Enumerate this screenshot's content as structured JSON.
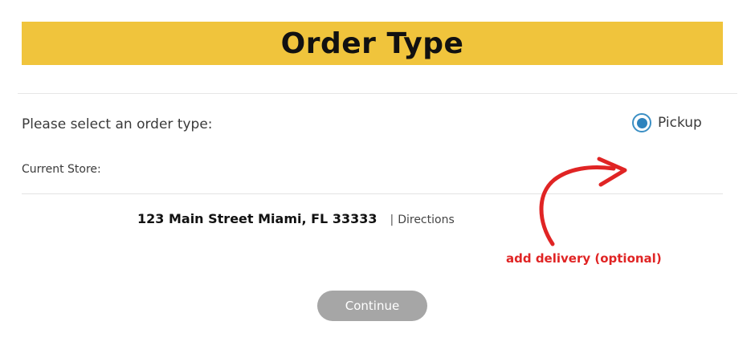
{
  "header": {
    "title": "Order Type"
  },
  "order_type": {
    "prompt": "Please select an order type:",
    "options": [
      {
        "label": "Pickup",
        "selected": true
      }
    ]
  },
  "store": {
    "label": "Current Store:",
    "address": "123 Main Street Miami, FL 33333",
    "separator": "|",
    "directions_label": "Directions"
  },
  "annotation": {
    "text": "add delivery (optional)",
    "color": "#e02424"
  },
  "actions": {
    "continue_label": "Continue"
  },
  "colors": {
    "banner": "#f0c43c",
    "radio_accent": "#2e83bd",
    "button": "#a6a6a6"
  }
}
